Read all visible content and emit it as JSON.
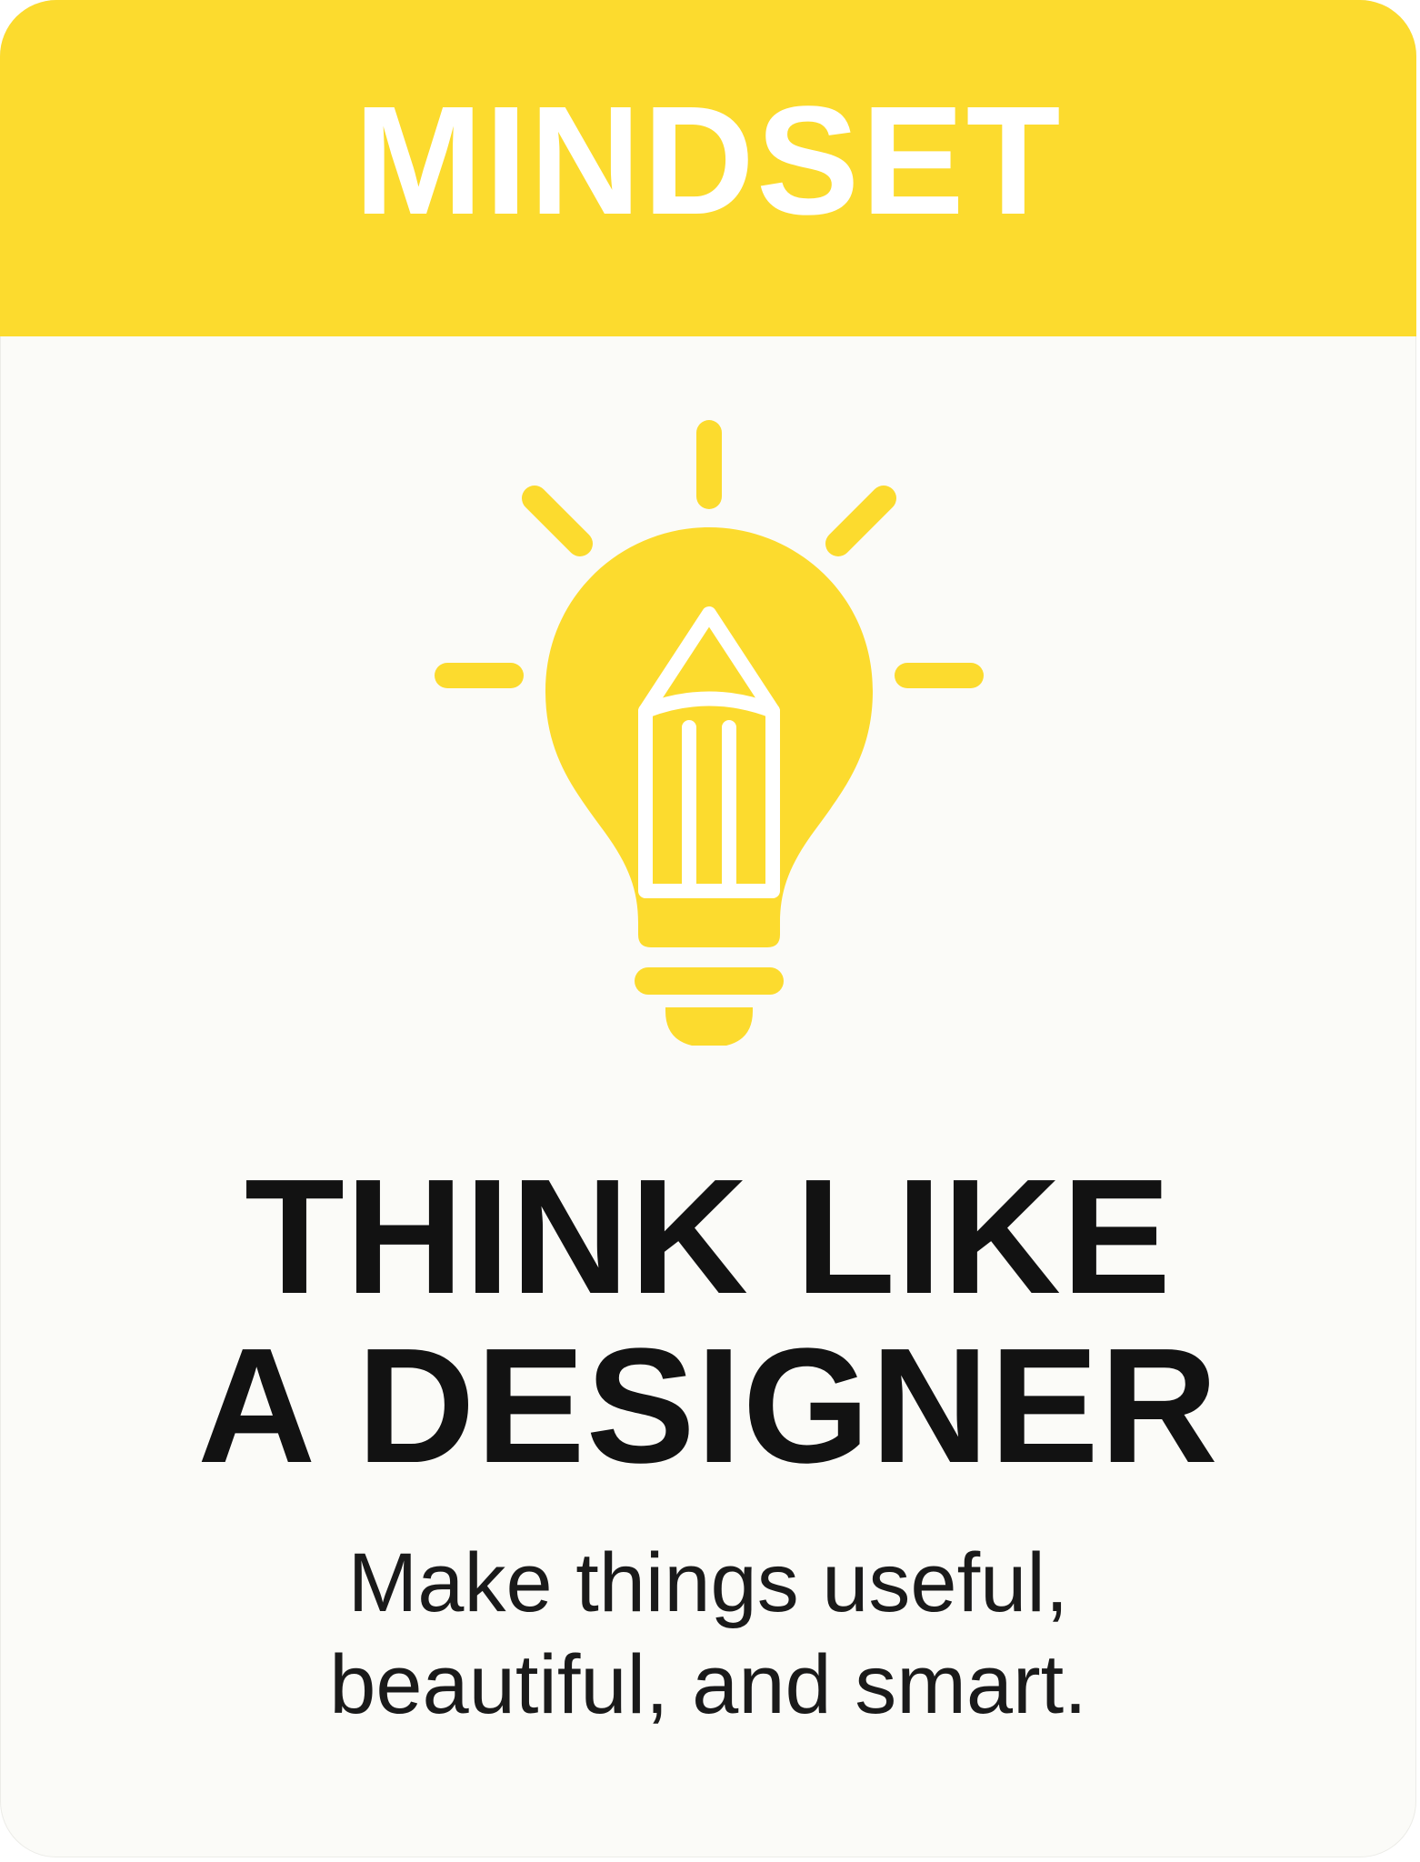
{
  "banner": {
    "title": "MINDSET"
  },
  "icon": {
    "name": "lightbulb-pencil-icon",
    "color": "#fcdb2e"
  },
  "headline": {
    "line1": "THINK LIKE",
    "line2": "A DESIGNER"
  },
  "tagline": {
    "line1": "Make things useful,",
    "line2": "beautiful, and smart."
  },
  "colors": {
    "accent": "#fcdb2e",
    "background": "#fbfbf8",
    "text": "#121212"
  }
}
